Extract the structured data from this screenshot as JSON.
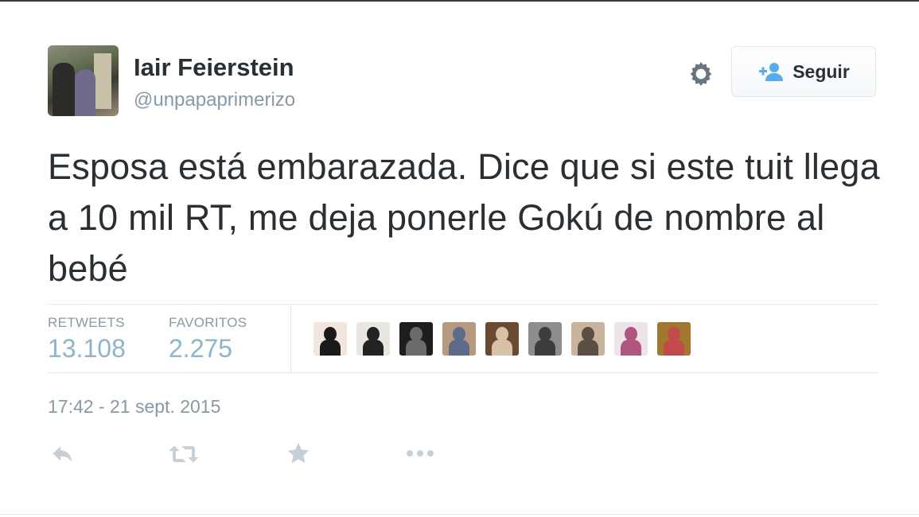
{
  "tweet": {
    "author_name": "Iair Feierstein",
    "author_handle": "@unpapaprimerizo",
    "text": "Esposa está embarazada. Dice que si este tuit llega a 10 mil RT, me deja ponerle Gokú de nombre al bebé",
    "timestamp": "17:42 - 21 sept. 2015",
    "follow_label": "Seguir",
    "stats": {
      "retweets_label": "RETWEETS",
      "retweets_count": "13.108",
      "favorites_label": "FAVORITOS",
      "favorites_count": "2.275"
    },
    "favoriter_avatars": [
      {
        "icon": "avatar-thumbnail",
        "bg": "#f0e6de",
        "fg": "#1a1a1a"
      },
      {
        "icon": "avatar-thumbnail",
        "bg": "#e9e6e2",
        "fg": "#222222"
      },
      {
        "icon": "avatar-thumbnail",
        "bg": "#1e1e1e",
        "fg": "#6b6b6b"
      },
      {
        "icon": "avatar-thumbnail",
        "bg": "#b79a7e",
        "fg": "#5a6c8a"
      },
      {
        "icon": "avatar-thumbnail",
        "bg": "#6b4a32",
        "fg": "#d8c2a5"
      },
      {
        "icon": "avatar-thumbnail",
        "bg": "#8d8d8d",
        "fg": "#3d3d3d"
      },
      {
        "icon": "avatar-thumbnail",
        "bg": "#c8b49a",
        "fg": "#5b4e44"
      },
      {
        "icon": "avatar-thumbnail",
        "bg": "#ece4e8",
        "fg": "#b0567d"
      },
      {
        "icon": "avatar-thumbnail",
        "bg": "#a2782f",
        "fg": "#c24a4a"
      }
    ],
    "actions": [
      "reply-icon",
      "retweet-icon",
      "favorite-star-icon",
      "more-options-icon"
    ]
  },
  "colors": {
    "text": "#292f33",
    "muted": "#8899a6",
    "count_blue": "#8ab4cf",
    "follow_icon": "#55acee",
    "icon_gray": "#c7d0d7",
    "gear": "#66757f"
  }
}
